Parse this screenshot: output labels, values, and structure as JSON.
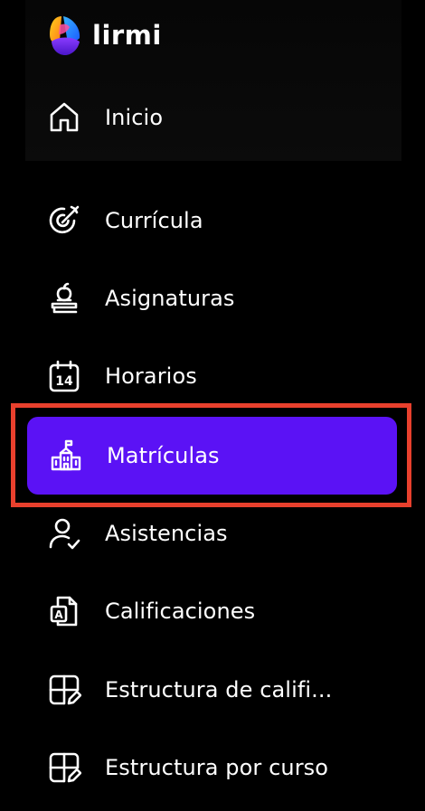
{
  "app": {
    "name": "lirmi"
  },
  "nav": {
    "home": {
      "label": "Inicio",
      "icon": "home-icon"
    },
    "items": [
      {
        "label": "Currícula",
        "icon": "target-edit-icon"
      },
      {
        "label": "Asignaturas",
        "icon": "apple-books-icon"
      },
      {
        "label": "Horarios",
        "icon": "calendar-14-icon"
      },
      {
        "label": "Matrículas",
        "icon": "school-building-icon",
        "active": true
      },
      {
        "label": "Asistencias",
        "icon": "user-check-icon"
      },
      {
        "label": "Calificaciones",
        "icon": "grade-document-icon"
      },
      {
        "label": "Estructura de califi...",
        "icon": "grid-edit-icon"
      },
      {
        "label": "Estructura por curso",
        "icon": "grid-edit-icon"
      }
    ]
  },
  "colors": {
    "active_bg": "#5b12f5",
    "highlight_border": "#e8402d",
    "background": "#000000"
  }
}
